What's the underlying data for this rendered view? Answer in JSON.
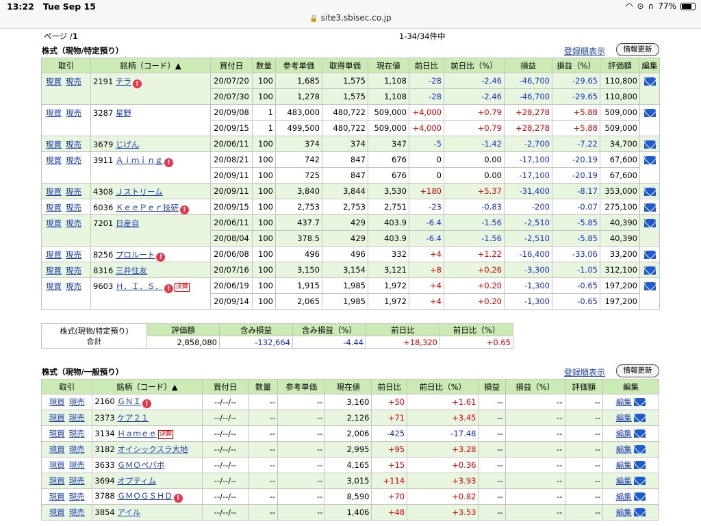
{
  "status": {
    "time": "13:22",
    "date": "Tue Sep 15",
    "battery": "77%",
    "url": "site3.sbisec.co.jp"
  },
  "pager": {
    "page_label": "ページ /",
    "page_num": "1",
    "count": "1-34/34件中"
  },
  "section1": {
    "title": "株式（現物/特定預り）",
    "register_link": "登録順表示",
    "update_button": "情報更新",
    "headers": [
      "取引",
      "銘柄（コード）▲",
      "買付日",
      "数量",
      "参考単価",
      "取得単価",
      "現在値",
      "前日比",
      "前日比（%）",
      "損益",
      "損益（%）",
      "評価額",
      "編集"
    ],
    "stocks": [
      {
        "code": "2191",
        "name": "テラ",
        "badge": "!",
        "kessan": "",
        "rows": [
          [
            "20/07/20",
            "100",
            "1,685",
            "1,575",
            "1,108",
            "-28",
            "-2.46",
            "-46,700",
            "-29.65",
            "110,800"
          ],
          [
            "20/07/30",
            "100",
            "1,278",
            "1,575",
            "1,108",
            "-28",
            "-2.46",
            "-46,700",
            "-29.65",
            "110,800"
          ]
        ]
      },
      {
        "code": "3287",
        "name": "星野",
        "badge": "",
        "kessan": "",
        "rows": [
          [
            "20/09/08",
            "1",
            "483,000",
            "480,722",
            "509,000",
            "+4,000",
            "+0.79",
            "+28,278",
            "+5.88",
            "509,000"
          ],
          [
            "20/09/15",
            "1",
            "499,500",
            "480,722",
            "509,000",
            "+4,000",
            "+0.79",
            "+28,278",
            "+5.88",
            "509,000"
          ]
        ]
      },
      {
        "code": "3679",
        "name": "じげん",
        "badge": "",
        "kessan": "",
        "rows": [
          [
            "20/06/11",
            "100",
            "374",
            "374",
            "347",
            "-5",
            "-1.42",
            "-2,700",
            "-7.22",
            "34,700"
          ]
        ]
      },
      {
        "code": "3911",
        "name": "Ａｉｍｉｎｇ",
        "badge": "!",
        "kessan": "",
        "rows": [
          [
            "20/08/21",
            "100",
            "742",
            "847",
            "676",
            "0",
            "0.00",
            "-17,100",
            "-20.19",
            "67,600"
          ],
          [
            "20/09/11",
            "100",
            "725",
            "847",
            "676",
            "0",
            "0.00",
            "-17,100",
            "-20.19",
            "67,600"
          ]
        ]
      },
      {
        "code": "4308",
        "name": "Ｊストリーム",
        "badge": "",
        "kessan": "",
        "rows": [
          [
            "20/09/11",
            "100",
            "3,840",
            "3,844",
            "3,530",
            "+180",
            "+5.37",
            "-31,400",
            "-8.17",
            "353,000"
          ]
        ]
      },
      {
        "code": "6036",
        "name": "ＫｅｅＰｅｒ技研",
        "badge": "!",
        "kessan": "",
        "rows": [
          [
            "20/09/15",
            "100",
            "2,753",
            "2,753",
            "2,751",
            "-23",
            "-0.83",
            "-200",
            "-0.07",
            "275,100"
          ]
        ]
      },
      {
        "code": "7201",
        "name": "日産自",
        "badge": "",
        "kessan": "",
        "rows": [
          [
            "20/06/11",
            "100",
            "437.7",
            "429",
            "403.9",
            "-6.4",
            "-1.56",
            "-2,510",
            "-5.85",
            "40,390"
          ],
          [
            "20/08/04",
            "100",
            "378.5",
            "429",
            "403.9",
            "-6.4",
            "-1.56",
            "-2,510",
            "-5.85",
            "40,390"
          ]
        ]
      },
      {
        "code": "8256",
        "name": "プロルート",
        "badge": "!",
        "kessan": "",
        "rows": [
          [
            "20/06/08",
            "100",
            "496",
            "496",
            "332",
            "+4",
            "+1.22",
            "-16,400",
            "-33.06",
            "33,200"
          ]
        ]
      },
      {
        "code": "8316",
        "name": "三井住友",
        "badge": "",
        "kessan": "",
        "rows": [
          [
            "20/07/16",
            "100",
            "3,150",
            "3,154",
            "3,121",
            "+8",
            "+0.26",
            "-3,300",
            "-1.05",
            "312,100"
          ]
        ]
      },
      {
        "code": "9603",
        "name": "Ｈ．Ｉ．Ｓ．",
        "badge": "!",
        "kessan": "決算",
        "rows": [
          [
            "20/06/19",
            "100",
            "1,915",
            "1,985",
            "1,972",
            "+4",
            "+0.20",
            "-1,300",
            "-0.65",
            "197,200"
          ],
          [
            "20/09/14",
            "100",
            "2,065",
            "1,985",
            "1,972",
            "+4",
            "+0.20",
            "-1,300",
            "-0.65",
            "197,200"
          ]
        ]
      }
    ],
    "trade_buy": "現買",
    "trade_sell": "現売"
  },
  "totals": {
    "label_line1": "株式(現物/特定預り)",
    "label_line2": "合計",
    "headers": [
      "評価額",
      "含み損益",
      "含み損益（%）",
      "前日比",
      "前日比（%）"
    ],
    "values": [
      "2,858,080",
      "-132,664",
      "-4.44",
      "+18,320",
      "+0.65"
    ]
  },
  "section2": {
    "title": "株式（現物/一般預り）",
    "register_link": "登録順表示",
    "update_button": "情報更新",
    "headers": [
      "取引",
      "銘柄（コード）▲",
      "買付日",
      "数量",
      "参考単価",
      "現在値",
      "前日比",
      "前日比（%）",
      "損益",
      "損益（%）",
      "評価額",
      "編集"
    ],
    "edit_label": "編集",
    "stocks": [
      {
        "code": "2160",
        "name": "ＧＮＩ",
        "badge": "!",
        "kessan": "",
        "price": "3,160",
        "chg": "+50",
        "chgp": "+1.61"
      },
      {
        "code": "2373",
        "name": "ケア２１",
        "badge": "",
        "kessan": "",
        "price": "2,126",
        "chg": "+71",
        "chgp": "+3.45"
      },
      {
        "code": "3134",
        "name": "Ｈａｍｅｅ",
        "badge": "",
        "kessan": "決算",
        "price": "2,006",
        "chg": "-425",
        "chgp": "-17.48"
      },
      {
        "code": "3182",
        "name": "オイシックスラ大地",
        "badge": "",
        "kessan": "",
        "price": "2,995",
        "chg": "+95",
        "chgp": "+3.28"
      },
      {
        "code": "3633",
        "name": "ＧＭＯペパボ",
        "badge": "",
        "kessan": "",
        "price": "4,165",
        "chg": "+15",
        "chgp": "+0.36"
      },
      {
        "code": "3694",
        "name": "オプティム",
        "badge": "",
        "kessan": "",
        "price": "3,015",
        "chg": "+114",
        "chgp": "+3.93"
      },
      {
        "code": "3788",
        "name": "ＧＭＯＧＳＨＤ",
        "badge": "!",
        "kessan": "",
        "price": "8,590",
        "chg": "+70",
        "chgp": "+0.82"
      },
      {
        "code": "3854",
        "name": "アイル",
        "badge": "",
        "kessan": "",
        "price": "1,406",
        "chg": "+48",
        "chgp": "+3.53"
      }
    ],
    "placeholder_date": "--/--/--",
    "placeholder_dash": "--"
  }
}
